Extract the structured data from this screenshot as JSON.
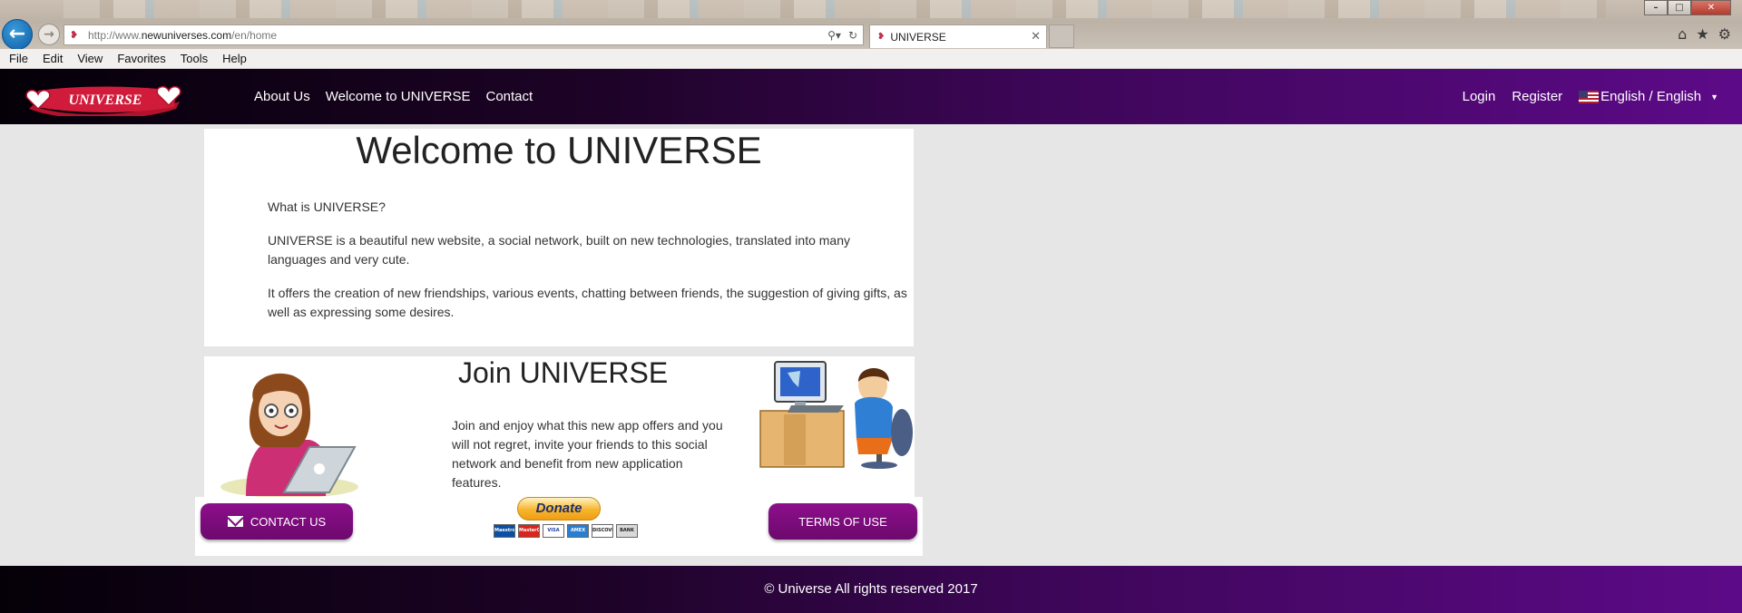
{
  "browser": {
    "url_prefix": "http://www.",
    "url_domain": "newuniverses.com",
    "url_path": "/en/home",
    "tab_title": "UNIVERSE",
    "menu": [
      "File",
      "Edit",
      "View",
      "Favorites",
      "Tools",
      "Help"
    ]
  },
  "header": {
    "logo_text": "UNIVERSE",
    "nav": [
      "About Us",
      "Welcome to UNIVERSE",
      "Contact"
    ],
    "login": "Login",
    "register": "Register",
    "language": "English / English"
  },
  "welcome": {
    "title": "Welcome to UNIVERSE",
    "paragraphs": [
      "What is UNIVERSE?",
      "UNIVERSE is a beautiful new website, a social network, built on new technologies, translated into many languages and very cute.",
      "It offers the creation of new friendships, various events, chatting between friends, the suggestion of giving gifts, as well as expressing some desires."
    ]
  },
  "join": {
    "title": "Join UNIVERSE",
    "body": "Join and enjoy what this new app offers and you will not regret, invite your friends to this social network and benefit from new application features."
  },
  "actions": {
    "contact": "CONTACT US",
    "terms": "TERMS OF USE",
    "donate": "Donate",
    "cards": [
      "Maestro",
      "MasterCard",
      "VISA",
      "AMEX",
      "DISCOVER",
      "BANK"
    ]
  },
  "footer": {
    "copyright": "© Universe All rights reserved 2017"
  },
  "colors": {
    "brand_purple": "#7a0c7a",
    "header_dark": "#050008",
    "header_light": "#5d0a88",
    "page_bg": "#e6e6e6"
  }
}
